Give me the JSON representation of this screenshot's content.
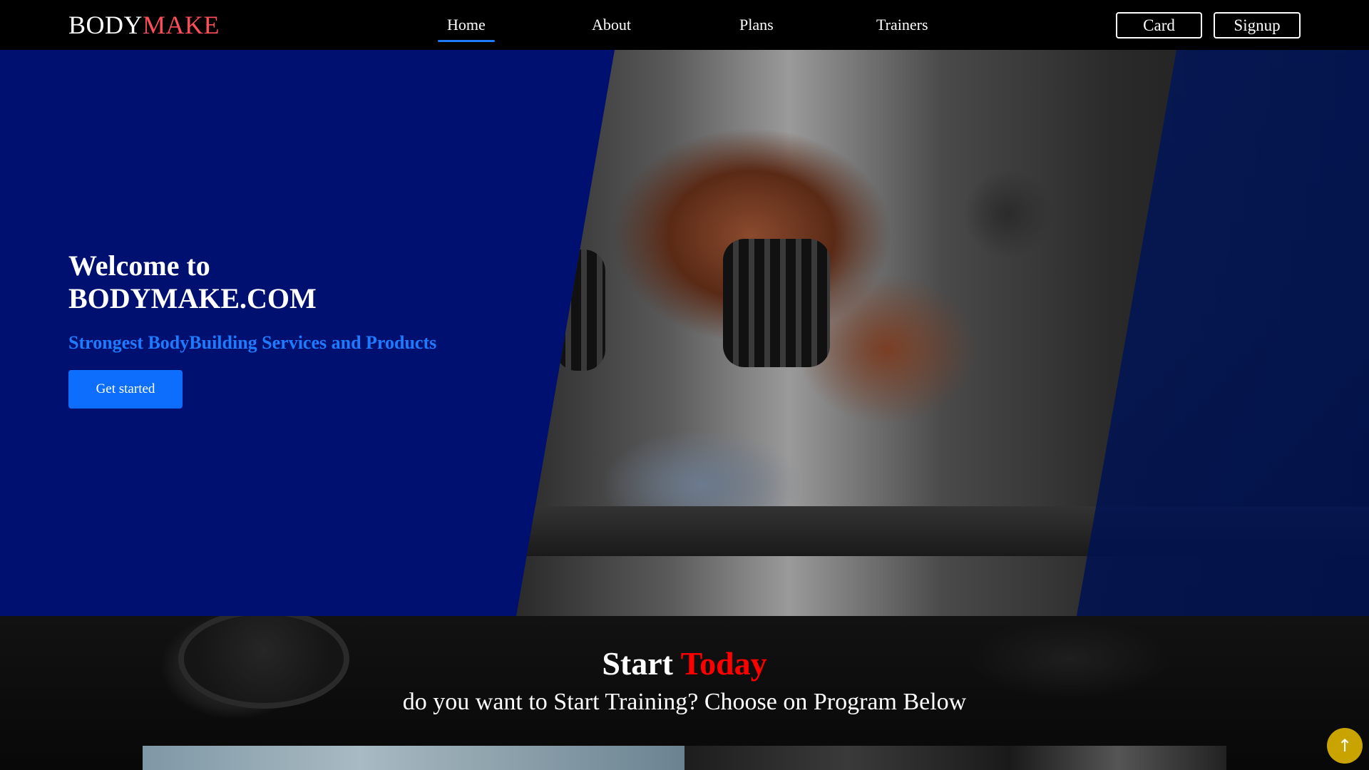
{
  "brand": {
    "part1": "BODY",
    "part2": "MAKE"
  },
  "nav": {
    "items": [
      {
        "label": "Home",
        "active": true
      },
      {
        "label": "About"
      },
      {
        "label": "Plans"
      },
      {
        "label": "Trainers"
      }
    ],
    "card_label": "Card",
    "signup_label": "Signup"
  },
  "hero": {
    "title_line1": "Welcome to",
    "title_line2": "BODYMAKE.COM",
    "subtitle": "Strongest BodyBuilding Services and Products",
    "cta_label": "Get started"
  },
  "start": {
    "title_white": "Start",
    "title_red": "Today",
    "subtitle": "do you want to Start Training? Choose on Program Below"
  },
  "scroll_top": {
    "icon": "arrow-up-icon",
    "glyph": "↑"
  },
  "colors": {
    "brand_accent": "#ff4d5a",
    "hero_bg": "#001070",
    "primary_blue": "#0d6efd",
    "highlight_red": "#ff0000",
    "scroll_top_bg": "#c9a400"
  }
}
